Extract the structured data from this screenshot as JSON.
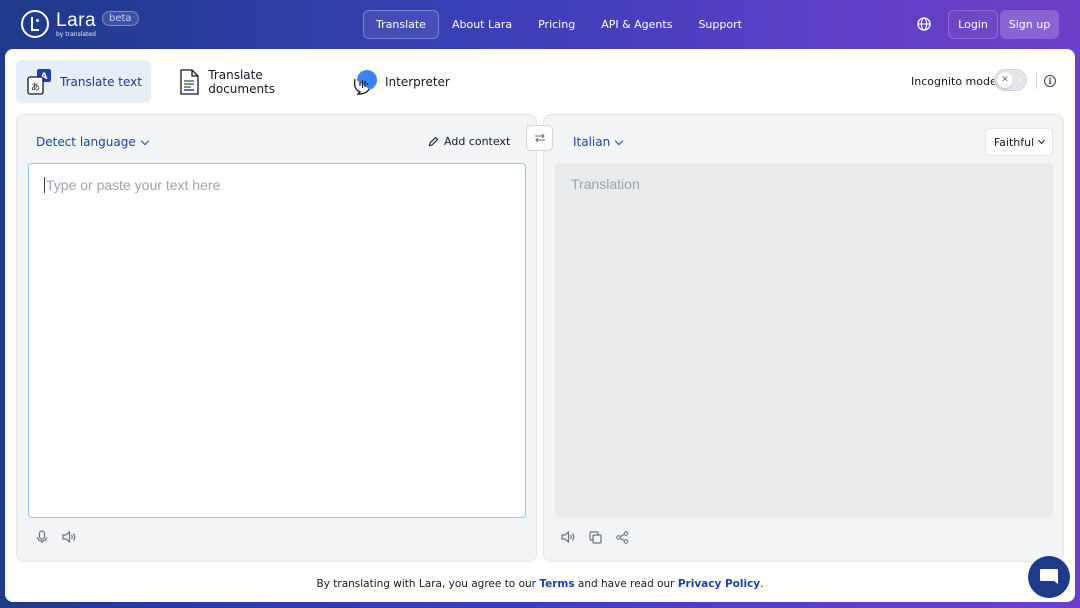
{
  "header": {
    "logo_name": "Lara",
    "logo_sub": "by translated",
    "beta": "beta",
    "nav": [
      "Translate",
      "About Lara",
      "Pricing",
      "API & Agents",
      "Support"
    ],
    "login": "Login",
    "signup": "Sign up"
  },
  "modes": {
    "text": "Translate text",
    "documents": "Translate documents",
    "interpreter": "Interpreter"
  },
  "incognito": {
    "label": "Incognito mode",
    "enabled": false
  },
  "source": {
    "language": "Detect language",
    "add_context": "Add context",
    "placeholder": "Type or paste your text here"
  },
  "target": {
    "language": "Italian",
    "style": "Faithful",
    "placeholder": "Translation"
  },
  "footer": {
    "prefix": "By translating with Lara, you agree to our",
    "terms": "Terms",
    "middle": "and have read our",
    "privacy": "Privacy Policy",
    "suffix": "."
  },
  "colors": {
    "accent": "#1e40af",
    "active_tab_bg": "#e6eef8",
    "header_gradient_start": "#1e3a8a",
    "header_gradient_end": "#6d3fc8"
  }
}
